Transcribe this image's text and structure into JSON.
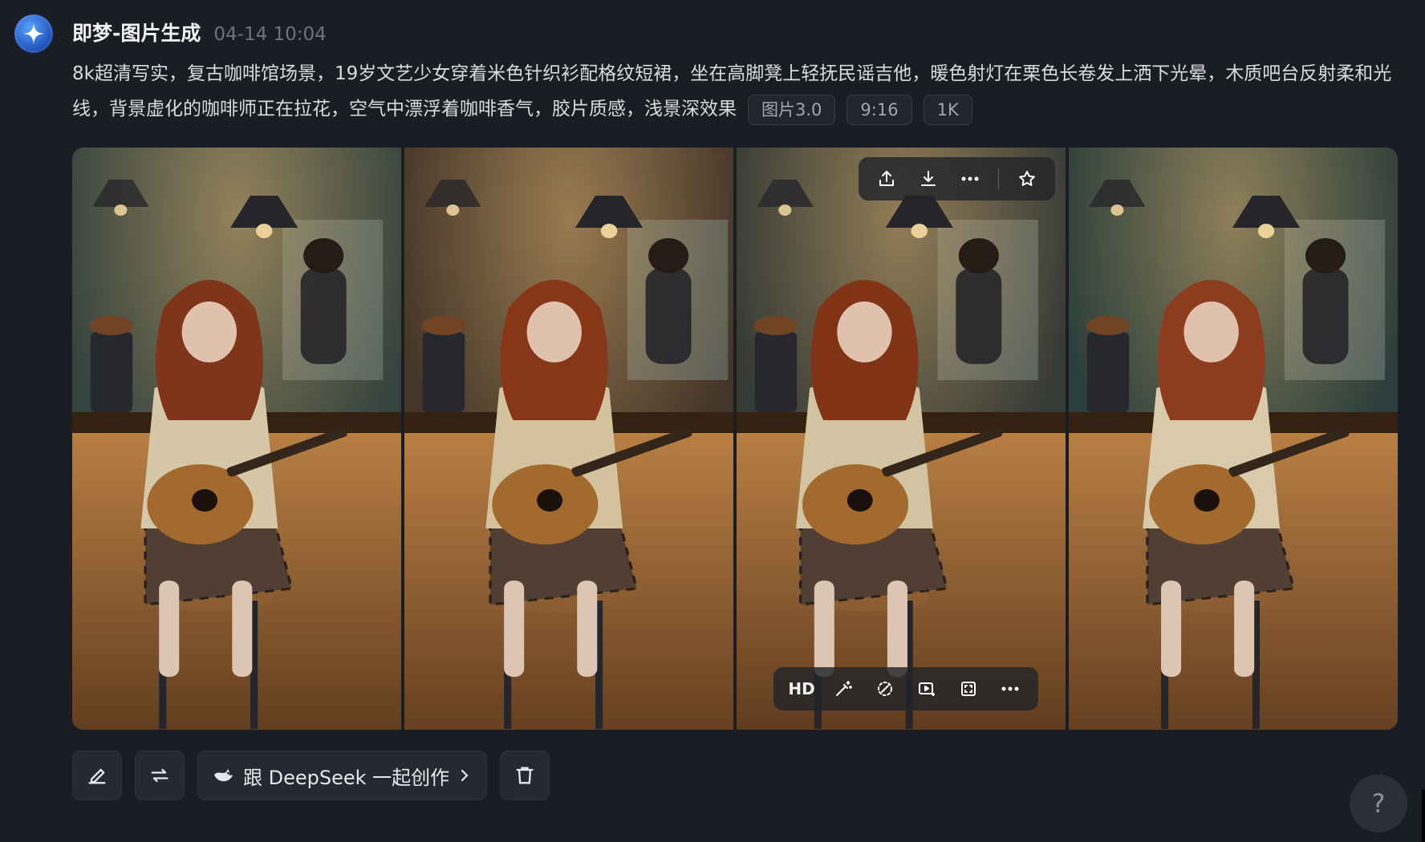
{
  "header": {
    "title": "即梦-图片生成",
    "timestamp": "04-14  10:04"
  },
  "prompt": {
    "text": "8k超清写实，复古咖啡馆场景，19岁文艺少女穿着米色针织衫配格纹短裙，坐在高脚凳上轻抚民谣吉他，暖色射灯在栗色长卷发上洒下光晕，木质吧台反射柔和光线，背景虚化的咖啡师正在拉花，空气中漂浮着咖啡香气，胶片质感，浅景深效果",
    "tags": [
      "图片3.0",
      "9:16",
      "1K"
    ]
  },
  "gallery": {
    "images": [
      "generated-image-1",
      "generated-image-2",
      "generated-image-3",
      "generated-image-4"
    ],
    "top_toolbar_icons": [
      "share-icon",
      "download-icon",
      "more-icon",
      "star-icon"
    ],
    "bottom_toolbar": {
      "hd_label": "HD",
      "icons": [
        "magic-wand-icon",
        "eraser-icon",
        "video-icon",
        "expand-icon",
        "more-icon"
      ]
    }
  },
  "actions": {
    "deepseek_label": "跟 DeepSeek 一起创作",
    "icons": [
      "edit-icon",
      "regenerate-icon",
      "deepseek-icon",
      "chevron-right-icon",
      "trash-icon"
    ]
  },
  "help": {
    "label": "?"
  },
  "colors": {
    "background": "#1b1d24",
    "warm_light": "#f1c27a",
    "tag_border": "#3a3d46"
  }
}
